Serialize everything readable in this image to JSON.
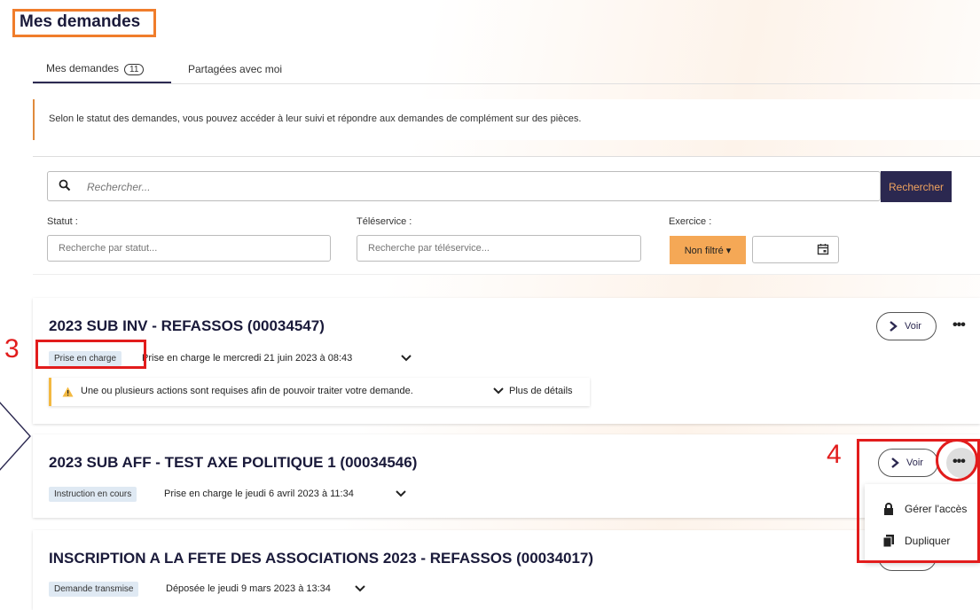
{
  "page": {
    "title": "Mes demandes"
  },
  "tabs": [
    {
      "label": "Mes demandes",
      "count": "11"
    },
    {
      "label": "Partagées avec moi"
    }
  ],
  "info": "Selon le statut des demandes, vous pouvez accéder à leur suivi et répondre aux demandes de complément sur des pièces.",
  "search": {
    "placeholder": "Rechercher...",
    "button": "Rechercher"
  },
  "filters": {
    "statut": {
      "label": "Statut :",
      "placeholder": "Recherche par statut..."
    },
    "teleservice": {
      "label": "Téléservice :",
      "placeholder": "Recherche par téléservice..."
    },
    "exercice": {
      "label": "Exercice :",
      "value": "Non filtré ▾"
    }
  },
  "requests": [
    {
      "title": "2023 SUB INV - REFASSOS (00034547)",
      "status": "Prise en charge",
      "detail": "Prise en charge le mercredi 21 juin 2023 à 08:43",
      "alert": "Une ou plusieurs actions sont requises afin de pouvoir traiter votre demande.",
      "alert_more": "Plus de détails"
    },
    {
      "title": "2023 SUB AFF - TEST AXE POLITIQUE 1 (00034546)",
      "status": "Instruction en cours",
      "detail": "Prise en charge le jeudi 6 avril 2023 à 11:34"
    },
    {
      "title": "INSCRIPTION A LA FETE DES ASSOCIATIONS 2023 - REFASSOS (00034017)",
      "status": "Demande transmise",
      "detail": "Déposée le jeudi 9 mars 2023 à 13:34"
    }
  ],
  "actions": {
    "voir": "Voir",
    "more": "•••"
  },
  "menu": [
    {
      "label": "Gérer l'accès",
      "icon": "lock-icon"
    },
    {
      "label": "Dupliquer",
      "icon": "copy-icon"
    }
  ],
  "annotations": {
    "three": "3",
    "four": "4"
  },
  "colors": {
    "accent_orange": "#f07d2b",
    "navy": "#2b2850",
    "annotation_red": "#e21c1c"
  }
}
